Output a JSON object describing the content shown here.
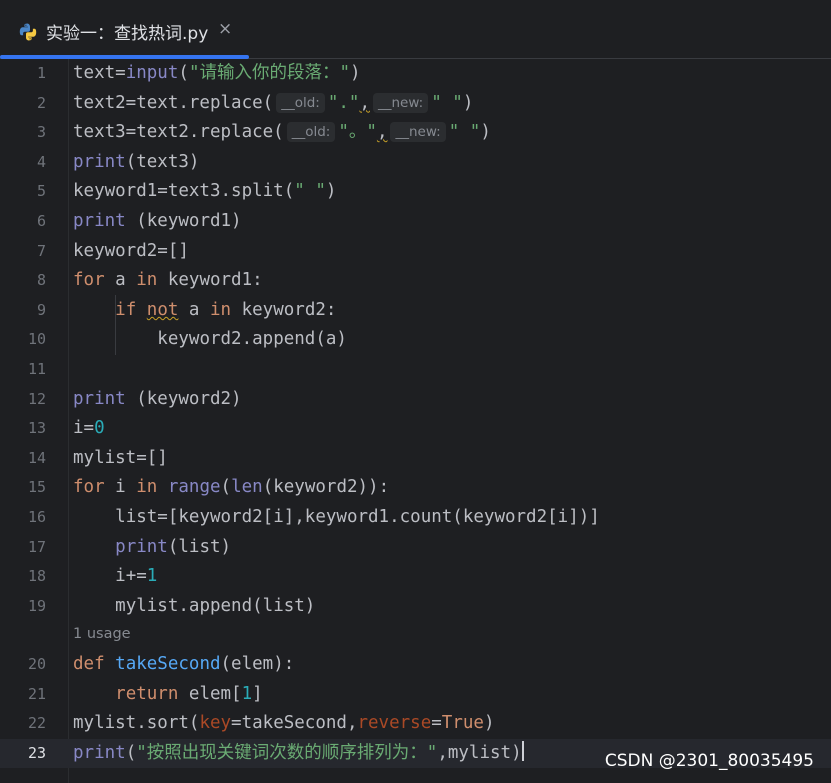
{
  "tab": {
    "title": "实验一：查找热词.py",
    "icon": "python-file-icon",
    "close_glyph": "×",
    "accent": "#3574f0"
  },
  "editor": {
    "current_line": "23",
    "usage_hint": "1 usage",
    "param_hints": {
      "old": "__old:",
      "new": "__new:"
    },
    "line_numbers": [
      "1",
      "2",
      "3",
      "4",
      "5",
      "6",
      "7",
      "8",
      "9",
      "10",
      "11",
      "12",
      "13",
      "14",
      "15",
      "16",
      "17",
      "18",
      "19",
      "20",
      "21",
      "22",
      "23"
    ],
    "code": {
      "l1_var": "text",
      "l1_eq": "=",
      "l1_func": "input",
      "l1_open": "(",
      "l1_str": "\"请输入你的段落：\"",
      "l1_close": ")",
      "l2_a": "text2=text.replace(",
      "l2_s1": "\".\"",
      "l2_comma": ",",
      "l2_s2": "\" \"",
      "l2_close": ")",
      "l3_a": "text3=text2.replace(",
      "l3_s1": "\"。\"",
      "l3_comma": ",",
      "l3_s2": "\" \"",
      "l3_close": ")",
      "l4_fn": "print",
      "l4_rest": "(text3)",
      "l5_a": "keyword1=text3.split(",
      "l5_s": "\" \"",
      "l5_close": ")",
      "l6_fn": "print",
      "l6_rest": " (keyword1)",
      "l7": "keyword2=[]",
      "l8_for": "for",
      "l8_a": " a ",
      "l8_in": "in",
      "l8_rest": " keyword1:",
      "l9_if": "if",
      "l9_not": "not",
      "l9_a": " a ",
      "l9_in": "in",
      "l9_rest": " keyword2:",
      "l10": "keyword2.append(a)",
      "l12_fn": "print",
      "l12_rest": " (keyword2)",
      "l13_a": "i=",
      "l13_num": "0",
      "l14": "mylist=[]",
      "l15_for": "for",
      "l15_i": " i ",
      "l15_in": "in",
      "l15_range": "range",
      "l15_open": "(",
      "l15_len": "len",
      "l15_rest": "(keyword2)):",
      "l16": "list=[keyword2[i],keyword1.count(keyword2[i])]",
      "l17_fn": "print",
      "l17_rest": "(list)",
      "l18_a": "i+=",
      "l18_num": "1",
      "l19": "mylist.append(list)",
      "l20_def": "def",
      "l20_name": "takeSecond",
      "l20_rest": "(elem):",
      "l21_ret": "return",
      "l21_a": " elem[",
      "l21_num": "1",
      "l21_close": "]",
      "l22_a": "mylist.sort(",
      "l22_key": "key",
      "l22_b": "=takeSecond,",
      "l22_rev": "reverse",
      "l22_c": "=",
      "l22_true": "True",
      "l22_close": ")",
      "l23_fn": "print",
      "l23_open": "(",
      "l23_str": "\"按照出现关键词次数的顺序排列为：\"",
      "l23_b": ",mylist",
      "l23_close": ")"
    }
  },
  "watermark": "CSDN @2301_80035495",
  "colors": {
    "background": "#1e1f22",
    "keyword": "#cf8e6d",
    "function": "#56a8f5",
    "builtin": "#8888c6",
    "string": "#6aab73",
    "number": "#2aacb8",
    "parameter": "#aa4926"
  }
}
